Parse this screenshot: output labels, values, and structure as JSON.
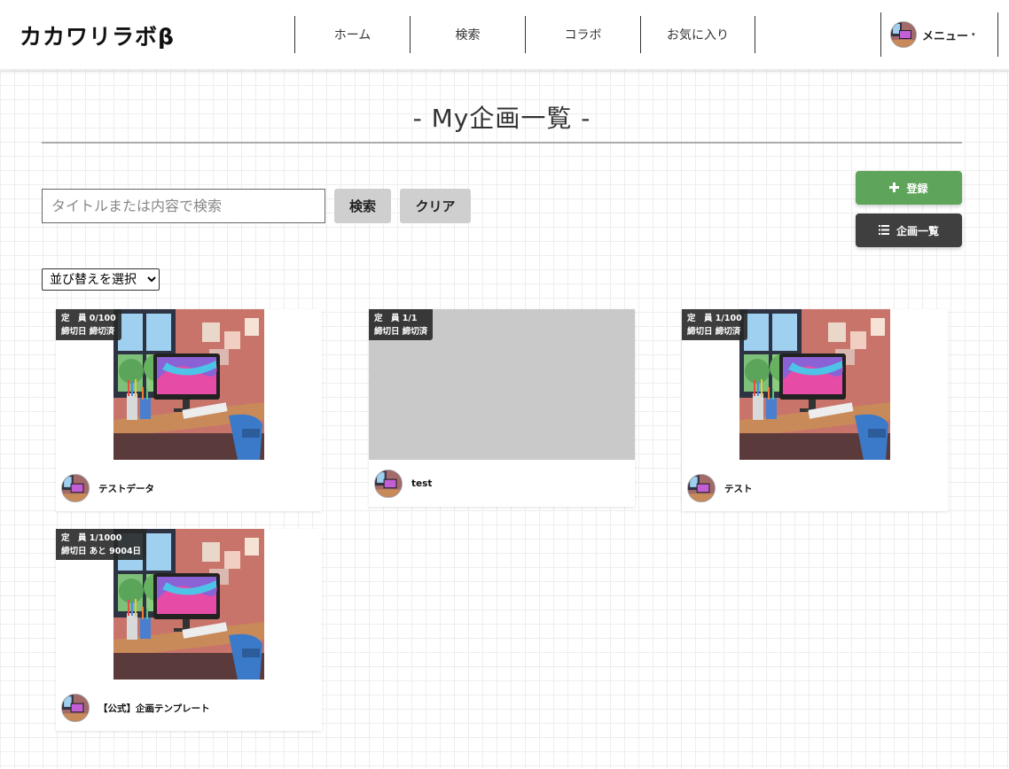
{
  "header": {
    "logo": "カカワリラボβ",
    "nav": [
      "ホーム",
      "検索",
      "コラボ",
      "お気に入り"
    ],
    "menu_label": "メニュー",
    "menu_caret": "▾"
  },
  "page": {
    "title": "- My企画一覧 -"
  },
  "search": {
    "placeholder": "タイトルまたは内容で検索",
    "search_label": "検索",
    "clear_label": "クリア"
  },
  "actions": {
    "register_label": "登録",
    "list_label": "企画一覧"
  },
  "sort": {
    "selected": "並び替えを選択"
  },
  "cards": [
    {
      "capacity": "定　員 0/100",
      "deadline": "締切日 締切済",
      "title": "テストデータ",
      "has_image": true
    },
    {
      "capacity": "定　員 1/1",
      "deadline": "締切日 締切済",
      "title": "test",
      "has_image": false
    },
    {
      "capacity": "定　員 1/100",
      "deadline": "締切日 締切済",
      "title": "テスト",
      "has_image": true
    },
    {
      "capacity": "定　員 1/1000",
      "deadline": "締切日 あと 9004日",
      "title": "【公式】企画テンプレート",
      "has_image": true
    }
  ],
  "colors": {
    "register_button": "#5fa45b",
    "list_button": "#3f3f3f",
    "badge_bg": "#282828"
  }
}
